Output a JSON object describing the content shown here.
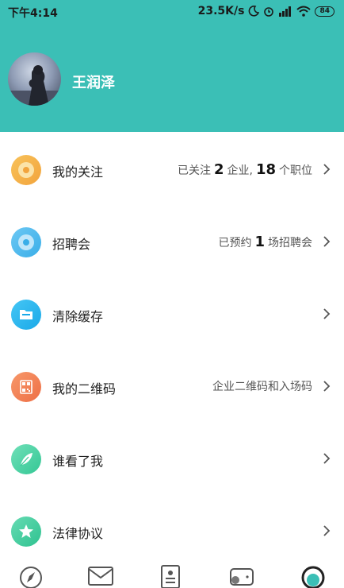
{
  "status": {
    "time": "下午4:14",
    "speed": "23.5K/s",
    "battery": "84"
  },
  "profile": {
    "name": "王润泽"
  },
  "menu": [
    {
      "label": "我的关注",
      "icon": "target-icon",
      "color": "#f5b24a",
      "right": {
        "pre": "已关注",
        "n1": "2",
        "mid": "企业,",
        "n2": "18",
        "post": "个职位"
      }
    },
    {
      "label": "招聘会",
      "icon": "target-icon",
      "color": "#4cb8ef",
      "right": {
        "pre": "已预约",
        "n1": "1",
        "mid": "场招聘会"
      }
    },
    {
      "label": "清除缓存",
      "icon": "folder-icon",
      "color": "#2eb6f0"
    },
    {
      "label": "我的二维码",
      "icon": "qrcode-icon",
      "color": "#f17f55",
      "right": {
        "text": "企业二维码和入场码"
      }
    },
    {
      "label": "谁看了我",
      "icon": "leaf-icon",
      "color": "#4dd3a6"
    },
    {
      "label": "法律协议",
      "icon": "star-icon",
      "color": "#45cfa2"
    }
  ]
}
